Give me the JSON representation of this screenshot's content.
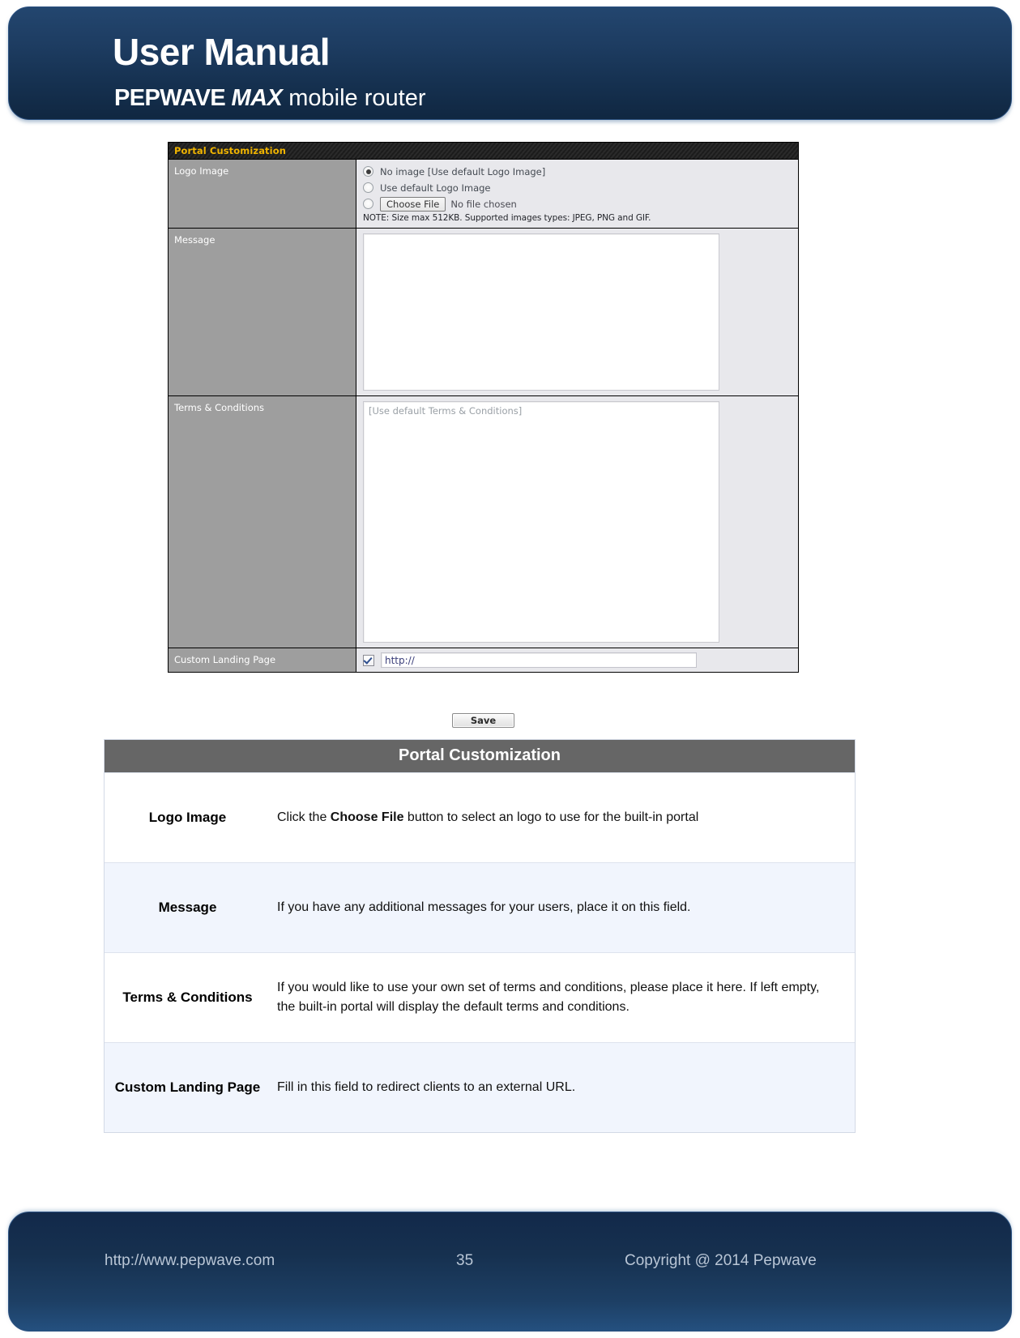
{
  "header": {
    "title": "User Manual",
    "brand_bold": "PEPWAVE ",
    "brand_italic": "MAX",
    "brand_light": " mobile router"
  },
  "screenshot": {
    "panel_title": "Portal Customization",
    "logo_image": {
      "label": "Logo Image",
      "options": [
        {
          "label": "No image [Use default Logo Image]",
          "selected": true
        },
        {
          "label": "Use default Logo Image",
          "selected": false
        },
        {
          "label": "",
          "selected": false
        }
      ],
      "choose_file_button": "Choose File",
      "no_file_text": "No file chosen",
      "note": "NOTE: Size max 512KB. Supported images types: JPEG, PNG and GIF."
    },
    "message": {
      "label": "Message",
      "value": ""
    },
    "terms": {
      "label": "Terms & Conditions",
      "placeholder": "[Use default Terms & Conditions]"
    },
    "landing": {
      "label": "Custom Landing Page",
      "checked": true,
      "value": "http://"
    },
    "save_button": "Save"
  },
  "description_table": {
    "title": "Portal Customization",
    "rows": [
      {
        "key": "Logo Image",
        "text_before": "Click the ",
        "text_bold": "Choose File",
        "text_after": " button to select an logo to use for the built-in portal"
      },
      {
        "key": "Message",
        "text_before": "If you have any additional messages for your users, place it on this field.",
        "text_bold": "",
        "text_after": ""
      },
      {
        "key": "Terms & Conditions",
        "text_before": "If you would like to use your own set of terms and conditions, please place it here. If left empty, the built-in portal will display the default terms and conditions.",
        "text_bold": "",
        "text_after": ""
      },
      {
        "key": "Custom Landing Page",
        "text_before": "Fill in this field to redirect clients to an external URL.",
        "text_bold": "",
        "text_after": ""
      }
    ]
  },
  "footer": {
    "url": "http://www.pepwave.com",
    "page_number": "35",
    "copyright": "Copyright @ 2014 Pepwave"
  },
  "colors": {
    "banner_dark": "#15304f",
    "panel_title": "#f0b400",
    "table_header_bg": "#666666",
    "table_alt_row": "#f1f5fd"
  }
}
